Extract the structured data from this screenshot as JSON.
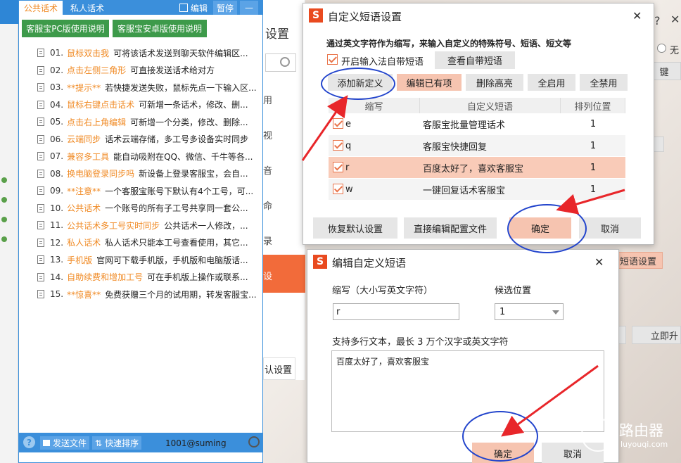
{
  "panel": {
    "tabs": [
      "公共话术",
      "私人话术"
    ],
    "edit_label": "编辑",
    "stop_label": "暂停",
    "min_label": "—",
    "guide_pc": "客服宝PC版使用说明",
    "guide_android": "客服宝安卓版使用说明",
    "phrases": [
      {
        "num": "01.",
        "title": "鼠标双击我",
        "desc": "可将该话术发送到聊天软件编辑区..."
      },
      {
        "num": "02.",
        "title": "点击左侧三角形",
        "desc": "可直接发送话术给对方"
      },
      {
        "num": "03.",
        "title": "**提示**",
        "desc": "若快捷发送失败，鼠标先点一下输入区..."
      },
      {
        "num": "04.",
        "title": "鼠标右键点击话术",
        "desc": "可新增一条话术，修改、删..."
      },
      {
        "num": "05.",
        "title": "点击右上角编辑",
        "desc": "可新增一个分类，修改、删除..."
      },
      {
        "num": "06.",
        "title": "云端同步",
        "desc": "话术云端存储，多工号多设备实时同步"
      },
      {
        "num": "07.",
        "title": "兼容多工具",
        "desc": "能自动吸附在QQ、微信、千牛等各..."
      },
      {
        "num": "08.",
        "title": "换电脑登录同步吗",
        "desc": "新设备上登录客服宝，会自..."
      },
      {
        "num": "09.",
        "title": "**注意**",
        "desc": "一个客服宝账号下默认有4个工号，可..."
      },
      {
        "num": "10.",
        "title": "公共话术",
        "desc": "一个账号的所有子工号共享同一套公..."
      },
      {
        "num": "11.",
        "title": "公共话术多工号实时同步",
        "desc": "公共话术一人修改，..."
      },
      {
        "num": "12.",
        "title": "私人话术",
        "desc": "私人话术只能本工号查看使用，其它..."
      },
      {
        "num": "13.",
        "title": "手机版",
        "desc": "官网可下载手机版，手机版和电脑版话..."
      },
      {
        "num": "14.",
        "title": "自助续费和增加工号",
        "desc": "可在手机版上操作或联系..."
      },
      {
        "num": "15.",
        "title": "**惊喜**",
        "desc": "免费获赠三个月的试用期，转发客服宝..."
      }
    ],
    "footer": {
      "help": "?",
      "send_file": "发送文件",
      "quick_sort": "快速排序",
      "account": "1001@suming"
    }
  },
  "background": {
    "title": "设置",
    "radio_label": "无",
    "btn_jian": "键",
    "btn_short": "短语设置",
    "btn_upgrade": "立即升",
    "reset_label": "认设置",
    "side_chars": [
      "用",
      "视",
      "音",
      "命",
      "录",
      "设"
    ]
  },
  "dialog1": {
    "logo": "S",
    "title": "自定义短语设置",
    "heading": "通过英文字符作为缩写，来输入自定义的特殊符号、短语、短文等",
    "enable_label": "开启输入法自带短语",
    "view_builtin": "查看自带短语",
    "actions": [
      "添加新定义",
      "编辑已有项",
      "删除高亮",
      "全启用",
      "全禁用"
    ],
    "columns": [
      "缩写",
      "自定义短语",
      "排列位置"
    ],
    "rows": [
      {
        "abbr": "e",
        "phrase": "客服宝批量管理话术",
        "pos": "1"
      },
      {
        "abbr": "q",
        "phrase": "客服宝快捷回复",
        "pos": "1"
      },
      {
        "abbr": "r",
        "phrase": "百度太好了，喜欢客服宝",
        "pos": "1"
      },
      {
        "abbr": "w",
        "phrase": "一键回复话术客服宝",
        "pos": "1"
      }
    ],
    "restore": "恢复默认设置",
    "edit_config": "直接编辑配置文件",
    "ok": "确定",
    "cancel": "取消",
    "close": "✕"
  },
  "dialog2": {
    "logo": "S",
    "title": "编辑自定义短语",
    "abbr_label": "缩写（大小写英文字符）",
    "pos_label": "候选位置",
    "abbr_value": "r",
    "pos_value": "1",
    "content_label": "支持多行文本，最长 3 万个汉字或英文字符",
    "content_value": "百度太好了，喜欢客服宝",
    "ok": "确定",
    "cancel": "取消",
    "close": "✕"
  },
  "watermark": {
    "brand": "路由器",
    "url": "luyouqi.com"
  },
  "colors": {
    "accent_blue": "#3b8fdb",
    "orange_text": "#f08a24",
    "highlight_row": "#f9cbb8",
    "green": "#3d9a4a",
    "annotation_blue": "#2244cc",
    "arrow_red": "#e8262a"
  }
}
